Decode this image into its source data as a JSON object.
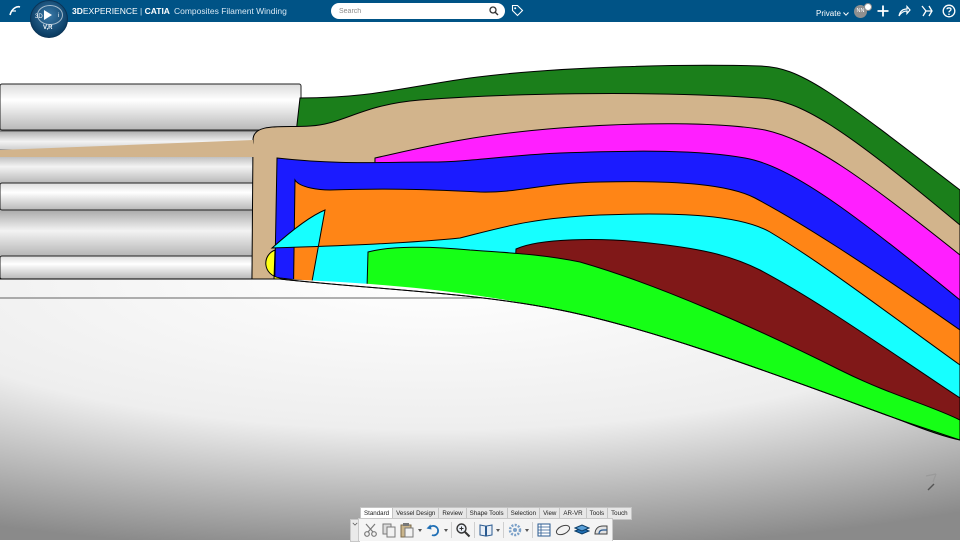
{
  "header": {
    "brand_bold": "3D",
    "brand_rest": "EXPERIENCE",
    "separator": " | ",
    "app_name": "CATIA",
    "app_role": "Composites Filament Winding",
    "compass": {
      "label_3d": "3D",
      "label_v": "V,R",
      "label_i": "i"
    },
    "search": {
      "placeholder": "Search",
      "value": ""
    },
    "collab_space": "Private",
    "user_initials": "NN",
    "icons": [
      "ds-logo",
      "search-icon",
      "tag-icon",
      "chevron-down-icon",
      "add-icon",
      "share-icon",
      "community-icon",
      "help-icon"
    ]
  },
  "viewport": {
    "background": "#ffffff",
    "ply_colors": [
      "#1b7f1b",
      "#d2b48c",
      "#ff1fff",
      "#1b1bff",
      "#ff8516",
      "#16ffff",
      "#801818",
      "#16ff16",
      "#ffff16"
    ]
  },
  "action_bar": {
    "tabs": [
      "Standard",
      "Vessel Design",
      "Review",
      "Shape Tools",
      "Selection",
      "View",
      "AR-VR",
      "Tools",
      "Touch"
    ],
    "active_tab": "Standard",
    "tools": [
      "cut-icon",
      "copy-icon",
      "paste-icon",
      "undo-icon",
      "zoom-icon",
      "book-icon",
      "gear-icon",
      "table-icon",
      "ellipse-icon",
      "layers-icon",
      "vessel-icon"
    ]
  },
  "colors": {
    "topbar": "#005386",
    "accent": "#0a6fb5"
  }
}
